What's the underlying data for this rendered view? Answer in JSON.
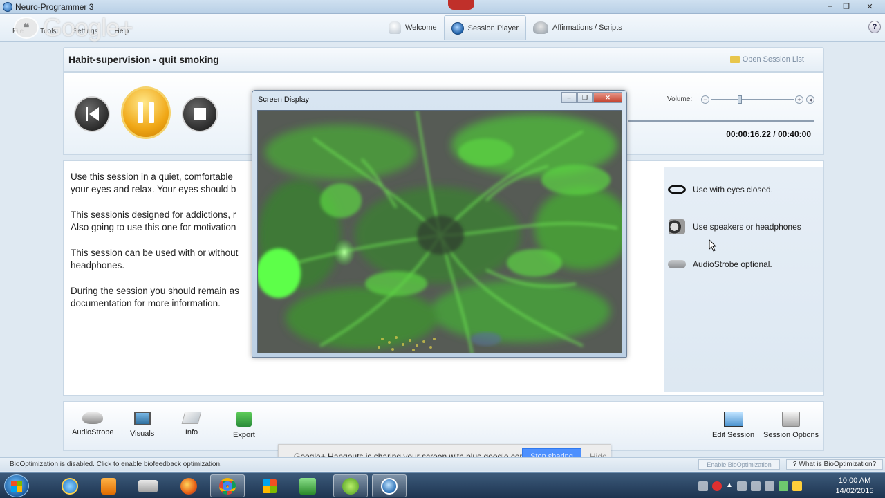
{
  "window": {
    "title": "Neuro-Programmer 3",
    "controls": [
      "‒",
      "❐",
      "✕"
    ]
  },
  "overlay": {
    "gplus_logo_text": "Google+"
  },
  "menu": {
    "items": [
      "File",
      "Tools",
      "Settings",
      "Help"
    ]
  },
  "nav_tabs": [
    {
      "label": "Welcome",
      "active": false
    },
    {
      "label": "Session Player",
      "active": true
    },
    {
      "label": "Affirmations / Scripts",
      "active": false
    }
  ],
  "help_label": "?",
  "session": {
    "title": "Habit-supervision - quit smoking",
    "open_list_label": "Open Session List"
  },
  "player": {
    "volume_label": "Volume:",
    "volume_level": 0.35,
    "elapsed_time": "00:00:16.22",
    "total_time": "00:40:00",
    "time_display": "00:00:16.22 / 00:40:00"
  },
  "description": {
    "paragraphs": [
      "Use this session in a quiet, comfortable your eyes and relax. Your eyes should b",
      "This sessionis designed for addictions, r Also going to use this one for motivation",
      "This session can be used with or without headphones.",
      "During the session you should remain as documentation for more information."
    ],
    "lines": [
      [
        "Use this session in a quiet, comfortable",
        "your eyes and relax. Your eyes should b"
      ],
      [
        "This sessionis designed for addictions, r",
        "Also going to use this one for motivation"
      ],
      [
        "This session can be used with or without",
        "headphones."
      ],
      [
        "During the session you should remain as",
        "documentation for more information."
      ]
    ]
  },
  "session_info": [
    {
      "icon": "eye-mask-icon",
      "label": "Use with eyes closed."
    },
    {
      "icon": "speaker-icon",
      "label": "Use speakers or headphones"
    },
    {
      "icon": "audiostrobe-icon",
      "label": "AudioStrobe optional."
    }
  ],
  "screen_display": {
    "title": "Screen Display"
  },
  "toolbar": {
    "left": [
      "AudioStrobe",
      "Visuals",
      "Info",
      "Export"
    ],
    "right": [
      "Edit Session",
      "Session Options"
    ]
  },
  "share_bar": {
    "message": "Google+ Hangouts is sharing your screen with plus.google.com.",
    "stop_label": "Stop sharing",
    "hide_label": "Hide"
  },
  "status": {
    "message": "BioOptimization is disabled. Click to enable biofeedback optimization.",
    "enable_label": "Enable BioOptimization",
    "what_is_label": "What is BioOptimization?"
  },
  "taskbar": {
    "apps": [
      "internet-explorer",
      "media-player",
      "file-explorer",
      "firefox",
      "chrome",
      "apps-grid",
      "hp-app",
      "utorrent",
      "neuro-programmer"
    ],
    "time": "10:00 AM",
    "date": "14/02/2015"
  },
  "colors": {
    "accent": "#f0a716",
    "title_bar": "#c4d8ec",
    "share_button": "#4d90fe",
    "visual_green": "#4ddc3c"
  }
}
